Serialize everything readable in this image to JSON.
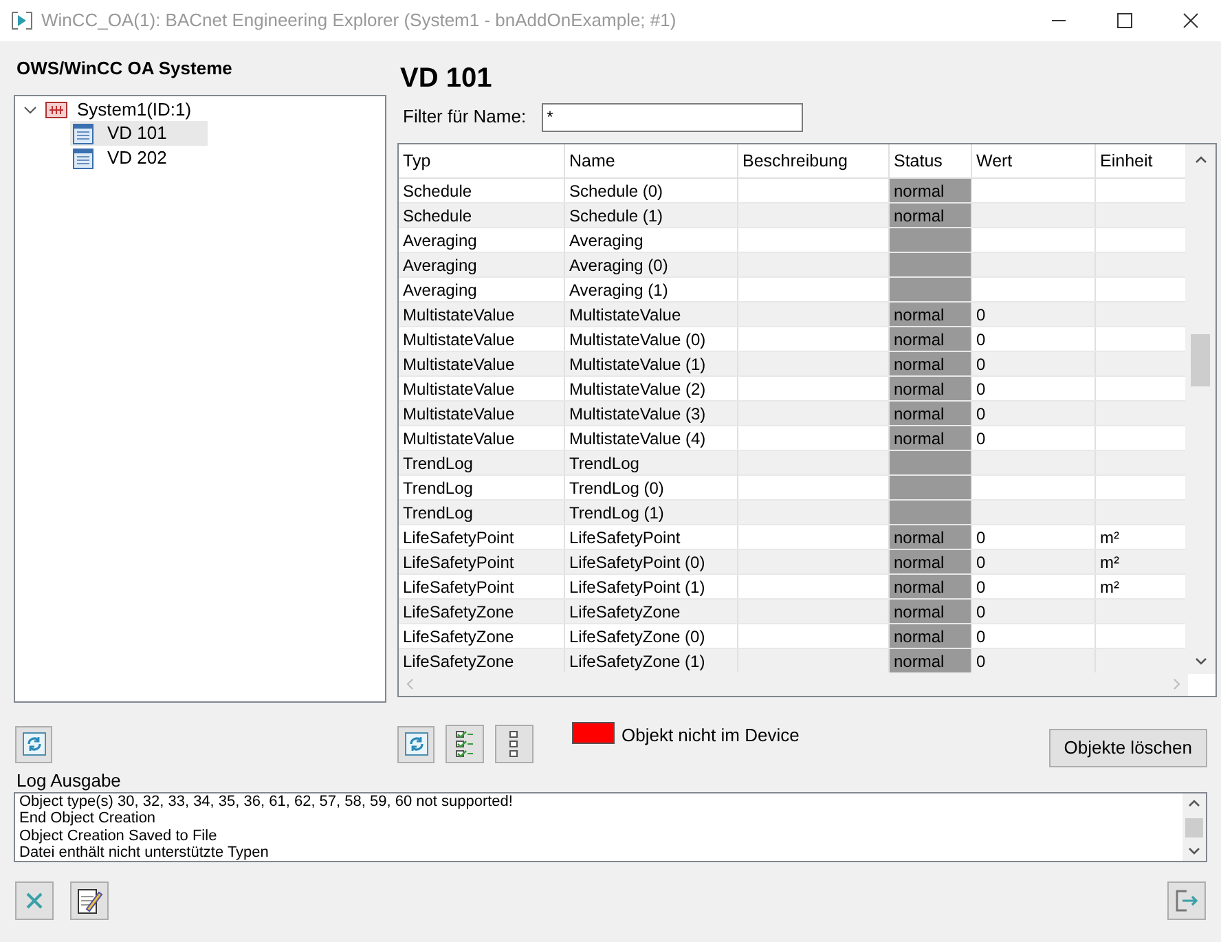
{
  "window": {
    "title": "WinCC_OA(1): BACnet Engineering Explorer (System1 - bnAddOnExample; #1)"
  },
  "sidebar": {
    "heading": "OWS/WinCC OA Systeme",
    "tree": [
      {
        "label": "System1(ID:1)",
        "expanded": true,
        "selected": false,
        "children": [
          {
            "label": "VD 101",
            "selected": true
          },
          {
            "label": "VD 202",
            "selected": false
          }
        ]
      }
    ]
  },
  "device": {
    "title": "VD 101",
    "filter_label": "Filter für Name:",
    "filter_value": "*"
  },
  "table": {
    "columns": [
      "Typ",
      "Name",
      "Beschreibung",
      "Status",
      "Wert",
      "Einheit"
    ],
    "rows": [
      [
        "Schedule",
        "Schedule (0)",
        "",
        "normal",
        "",
        ""
      ],
      [
        "Schedule",
        "Schedule (1)",
        "",
        "normal",
        "",
        ""
      ],
      [
        "Averaging",
        "Averaging",
        "",
        "",
        "",
        ""
      ],
      [
        "Averaging",
        "Averaging (0)",
        "",
        "",
        "",
        ""
      ],
      [
        "Averaging",
        "Averaging (1)",
        "",
        "",
        "",
        ""
      ],
      [
        "MultistateValue",
        "MultistateValue",
        "",
        "normal",
        "0",
        ""
      ],
      [
        "MultistateValue",
        "MultistateValue (0)",
        "",
        "normal",
        "0",
        ""
      ],
      [
        "MultistateValue",
        "MultistateValue (1)",
        "",
        "normal",
        "0",
        ""
      ],
      [
        "MultistateValue",
        "MultistateValue (2)",
        "",
        "normal",
        "0",
        ""
      ],
      [
        "MultistateValue",
        "MultistateValue (3)",
        "",
        "normal",
        "0",
        ""
      ],
      [
        "MultistateValue",
        "MultistateValue (4)",
        "",
        "normal",
        "0",
        ""
      ],
      [
        "TrendLog",
        "TrendLog",
        "",
        "",
        "",
        ""
      ],
      [
        "TrendLog",
        "TrendLog (0)",
        "",
        "",
        "",
        ""
      ],
      [
        "TrendLog",
        "TrendLog (1)",
        "",
        "",
        "",
        ""
      ],
      [
        "LifeSafetyPoint",
        "LifeSafetyPoint",
        "",
        "normal",
        "0",
        "m²"
      ],
      [
        "LifeSafetyPoint",
        "LifeSafetyPoint (0)",
        "",
        "normal",
        "0",
        "m²"
      ],
      [
        "LifeSafetyPoint",
        "LifeSafetyPoint (1)",
        "",
        "normal",
        "0",
        "m²"
      ],
      [
        "LifeSafetyZone",
        "LifeSafetyZone",
        "",
        "normal",
        "0",
        ""
      ],
      [
        "LifeSafetyZone",
        "LifeSafetyZone (0)",
        "",
        "normal",
        "0",
        ""
      ],
      [
        "LifeSafetyZone",
        "LifeSafetyZone (1)",
        "",
        "normal",
        "0",
        ""
      ]
    ]
  },
  "legend": {
    "label": "Objekt nicht im Device",
    "color": "#ff0000"
  },
  "delete_button": "Objekte löschen",
  "log": {
    "label": "Log Ausgabe",
    "lines": [
      "Object type(s) 30, 32, 33, 34, 35, 36, 61, 62, 57, 58, 59, 60 not supported!",
      "End Object Creation",
      "Object Creation Saved to File",
      "Datei enthält nicht unterstützte Typen"
    ]
  }
}
